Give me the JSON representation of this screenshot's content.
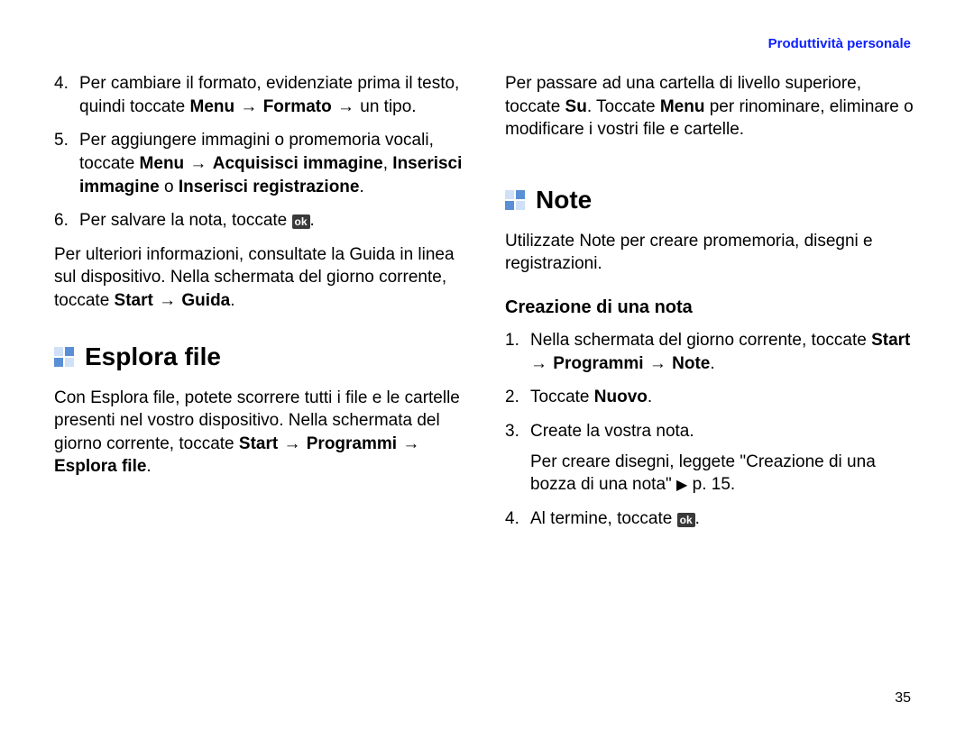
{
  "header": {
    "section": "Produttività personale"
  },
  "left": {
    "item4": {
      "num": "4.",
      "pre": "Per cambiare il formato, evidenziate prima il testo, quindi toccate ",
      "menu": "Menu",
      "arrow1": " → ",
      "formato": "Formato",
      "arrow2": " → ",
      "post": "un tipo."
    },
    "item5": {
      "num": "5.",
      "pre": "Per aggiungere immagini o promemoria vocali, toccate ",
      "menu": "Menu",
      "arrow": " → ",
      "acq": "Acquisisci immagine",
      "sep1": ", ",
      "ins_img": "Inserisci immagine",
      "sep2": " o ",
      "ins_rec": "Inserisci registrazione",
      "end": "."
    },
    "item6": {
      "num": "6.",
      "pre": "Per salvare la nota, toccate ",
      "ok": "ok",
      "end": "."
    },
    "info": {
      "pre": "Per ulteriori informazioni, consultate la Guida in linea sul dispositivo. Nella schermata del giorno corrente, toccate ",
      "start": "Start",
      "arrow": " → ",
      "guida": "Guida",
      "end": "."
    },
    "sec_title": "Esplora file",
    "sec_body": {
      "pre": "Con Esplora file, potete scorrere tutti i file e le cartelle presenti nel vostro dispositivo. Nella schermata del giorno corrente, toccate ",
      "start": "Start",
      "arrow1": " → ",
      "prog": "Programmi",
      "arrow2": " → ",
      "expl": "Esplora file",
      "end": "."
    }
  },
  "right": {
    "top": {
      "pre": "Per passare ad una cartella di livello superiore, toccate ",
      "su": "Su",
      "mid": ". Toccate ",
      "menu": "Menu",
      "post": " per rinominare, eliminare o modificare i vostri file e cartelle."
    },
    "sec_title": "Note",
    "sec_intro": "Utilizzate Note per creare promemoria, disegni e registrazioni.",
    "sub": "Creazione di una nota",
    "n1": {
      "num": "1.",
      "pre": "Nella schermata del giorno corrente, toccate ",
      "start": "Start",
      "arrow1": " → ",
      "prog": "Programmi",
      "arrow2": " → ",
      "note": "Note",
      "end": "."
    },
    "n2": {
      "num": "2.",
      "pre": "Toccate ",
      "nuovo": "Nuovo",
      "end": "."
    },
    "n3": {
      "num": "3.",
      "line1": "Create la vostra nota.",
      "line2": "Per creare disegni, leggete \"Creazione di una bozza di una nota\" ",
      "tri": "▶",
      "page_ref": " p. 15."
    },
    "n4": {
      "num": "4.",
      "pre": "Al termine, toccate ",
      "ok": "ok",
      "end": "."
    }
  },
  "page_number": "35"
}
